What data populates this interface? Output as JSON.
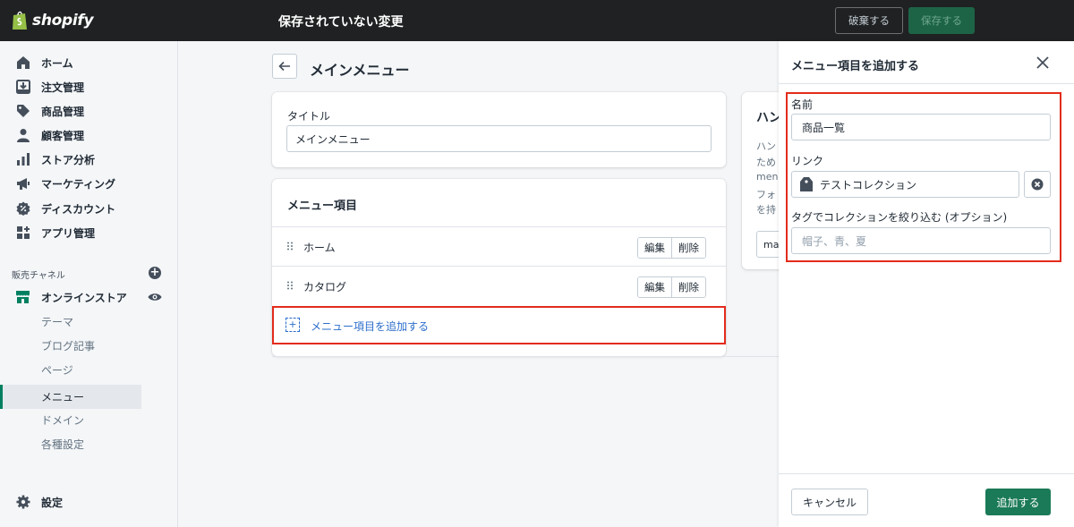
{
  "topbar": {
    "logo_text": "shopify",
    "unsaved_title": "保存されていない変更",
    "discard_label": "破棄する",
    "save_label": "保存する"
  },
  "sidebar": {
    "items": [
      {
        "label": "ホーム",
        "icon": "home-icon"
      },
      {
        "label": "注文管理",
        "icon": "orders-icon"
      },
      {
        "label": "商品管理",
        "icon": "tag-icon"
      },
      {
        "label": "顧客管理",
        "icon": "person-icon"
      },
      {
        "label": "ストア分析",
        "icon": "bar-chart-icon"
      },
      {
        "label": "マーケティング",
        "icon": "megaphone-icon"
      },
      {
        "label": "ディスカウント",
        "icon": "discount-icon"
      },
      {
        "label": "アプリ管理",
        "icon": "apps-icon"
      }
    ],
    "channels_heading": "販売チャネル",
    "online_store_label": "オンラインストア",
    "sub_items": [
      "テーマ",
      "ブログ記事",
      "ページ",
      "メニュー",
      "ドメイン",
      "各種設定"
    ],
    "active_sub_item": "メニュー",
    "settings_label": "設定"
  },
  "main": {
    "page_title": "メインメニュー",
    "title_label": "タイトル",
    "title_value": "メインメニュー",
    "menu_items_heading": "メニュー項目",
    "menu_items": [
      {
        "label": "ホーム",
        "edit": "編集",
        "delete": "削除"
      },
      {
        "label": "カタログ",
        "edit": "編集",
        "delete": "削除"
      }
    ],
    "add_item_label": "メニュー項目を追加する",
    "handle_card": {
      "title": "ハン",
      "lines": [
        "ハン",
        "ため",
        "menu",
        "フォ",
        "を持"
      ],
      "input_value": "ma"
    }
  },
  "panel": {
    "title": "メニュー項目を追加する",
    "name_label": "名前",
    "name_value": "商品一覧",
    "link_label": "リンク",
    "link_value": "テストコレクション",
    "tag_filter_label": "タグでコレクションを絞り込む (オプション)",
    "tag_filter_placeholder": "帽子、青、夏",
    "cancel_label": "キャンセル",
    "add_label": "追加する"
  },
  "colors": {
    "topbar_bg": "#1f2122",
    "primary_green": "#1b7a57",
    "highlight_red": "#e32b1c",
    "link_blue": "#2c6ecb"
  }
}
